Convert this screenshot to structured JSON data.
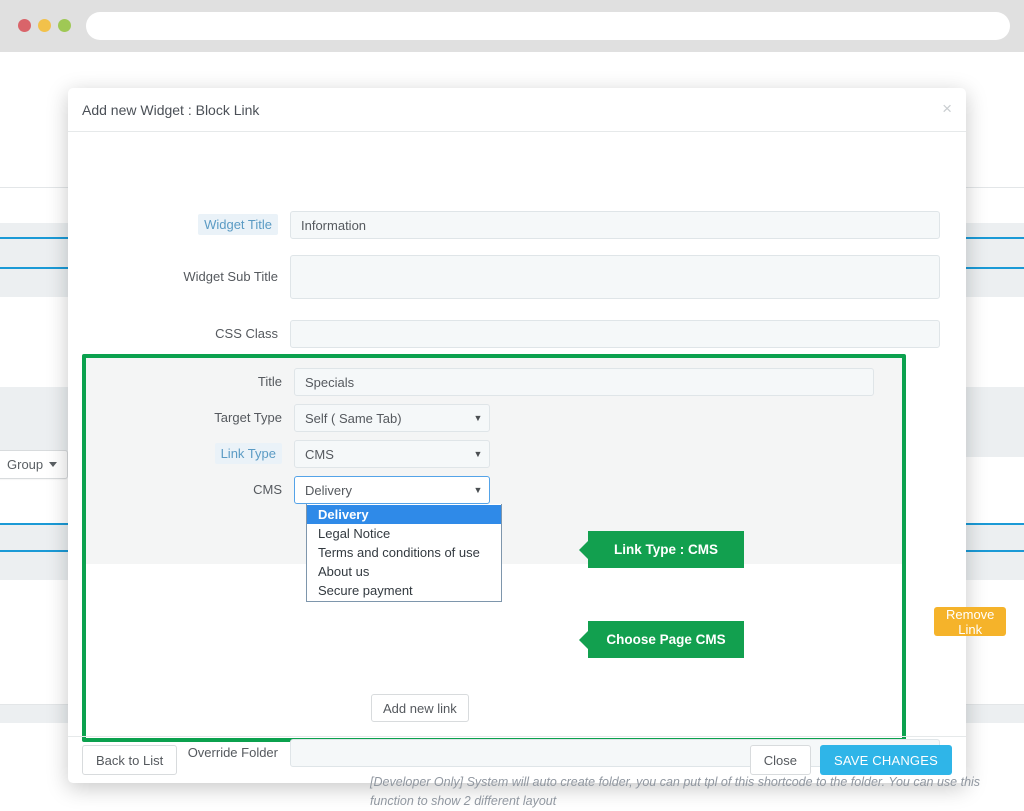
{
  "browser": {
    "address_value": "",
    "address_placeholder": "",
    "traffic_lights": [
      "close-red",
      "minimize-yellow",
      "maximize-green"
    ]
  },
  "background": {
    "group_button_label": "Group",
    "group_caret_icon": "caret-down-icon"
  },
  "modal": {
    "title": "Add new Widget : Block Link",
    "close_icon": "close-icon",
    "close_glyph": "×"
  },
  "form": {
    "widget_title": {
      "label": "Widget Title",
      "value": "Information",
      "placeholder": "",
      "highlighted": true
    },
    "widget_sub_title": {
      "label": "Widget Sub Title",
      "value": "",
      "placeholder": "",
      "highlighted": false
    },
    "css_class": {
      "label": "CSS Class",
      "value": "",
      "placeholder": "",
      "highlighted": false
    },
    "override_folder": {
      "label": "Override Folder",
      "value": "",
      "placeholder": "",
      "help": "[Developer Only] System will auto create folder, you can put tpl of this shortcode to the folder. You can use this function to show 2 different layout"
    }
  },
  "link_block": {
    "title": {
      "label": "Title",
      "value": "Specials",
      "placeholder": ""
    },
    "target_type": {
      "label": "Target Type",
      "value": "Self ( Same Tab)",
      "caret_icon": "caret-down-icon",
      "options": [
        "Self ( Same Tab)"
      ]
    },
    "link_type": {
      "label": "Link Type",
      "value": "CMS",
      "caret_icon": "caret-down-icon",
      "highlighted": true,
      "options": [
        "CMS"
      ]
    },
    "cms": {
      "label": "CMS",
      "value": "Delivery",
      "caret_icon": "caret-down-icon",
      "open": true,
      "options": [
        {
          "label": "Delivery",
          "selected": true
        },
        {
          "label": "Legal Notice",
          "selected": false
        },
        {
          "label": "Terms and conditions of use",
          "selected": false
        },
        {
          "label": "About us",
          "selected": false
        },
        {
          "label": "Secure payment",
          "selected": false
        }
      ]
    },
    "remove_link_label": "Remove Link",
    "add_new_link_label": "Add new link"
  },
  "callouts": [
    {
      "text": "Link Type : CMS",
      "name": "callout-link-type"
    },
    {
      "text": "Choose  Page CMS",
      "name": "callout-choose-page-cms"
    }
  ],
  "footer": {
    "back_to_list_label": "Back to List",
    "close_label": "Close",
    "save_changes_label": "SAVE CHANGES"
  },
  "colors": {
    "highlight_green": "#12a04f",
    "block_border_green": "#0ba14e",
    "warning_orange": "#f5b32a",
    "primary_blue": "#2fb5e8",
    "select_focus_blue": "#54a3e8",
    "option_selected_blue": "#2f8ae8"
  }
}
